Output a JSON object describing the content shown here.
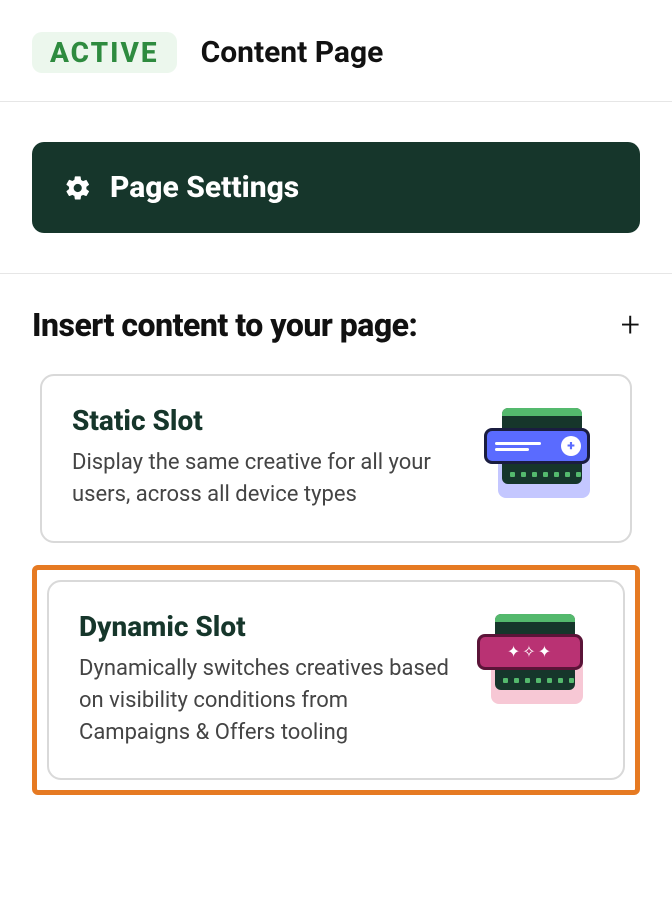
{
  "header": {
    "status": "ACTIVE",
    "title": "Content Page"
  },
  "settings": {
    "label": "Page Settings"
  },
  "section": {
    "title": "Insert content to your page:"
  },
  "options": {
    "static": {
      "title": "Static Slot",
      "desc": "Display the same creative for all your users, across all device types"
    },
    "dynamic": {
      "title": "Dynamic Slot",
      "desc": "Dynamically switches creatives based on visibility conditions from Campaigns & Offers tooling"
    }
  }
}
